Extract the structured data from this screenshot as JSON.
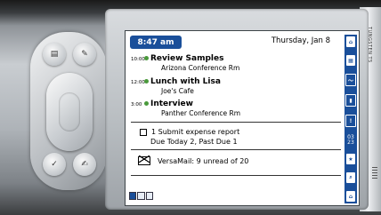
{
  "device": {
    "brand": "TUNGSTEN T5"
  },
  "hardware_keys": [
    {
      "name": "calendar-key",
      "glyph": "▤"
    },
    {
      "name": "contacts-key",
      "glyph": "✎"
    },
    {
      "name": "tasks-key",
      "glyph": "✓"
    },
    {
      "name": "notes-key",
      "glyph": "✍"
    }
  ],
  "header": {
    "time": "8:47 am",
    "date": "Thursday, Jan 8"
  },
  "appointments": [
    {
      "time": "10:00",
      "title": "Review Samples",
      "location": "Arizona Conference Rm"
    },
    {
      "time": "12:00",
      "title": "Lunch with Lisa",
      "location": "Joe's Cafe"
    },
    {
      "time": "3:00",
      "title": "Interview",
      "location": "Panther Conference Rm"
    }
  ],
  "task": {
    "number": "1",
    "title": "Submit expense report",
    "due": "Due Today 2, Past Due 1"
  },
  "mail": {
    "label": "VersaMail: 9 unread of 20"
  },
  "sidebar": {
    "icons": [
      "home-icon",
      "calendar-icon",
      "graffiti-icon",
      "battery-icon",
      "alert-icon",
      "numbers-icon",
      "star-icon",
      "search-icon",
      "app-icon"
    ],
    "numbers": [
      "03",
      "23"
    ]
  },
  "colors": {
    "accent": "#1a4f9a",
    "dot": "#4a9a3c"
  }
}
